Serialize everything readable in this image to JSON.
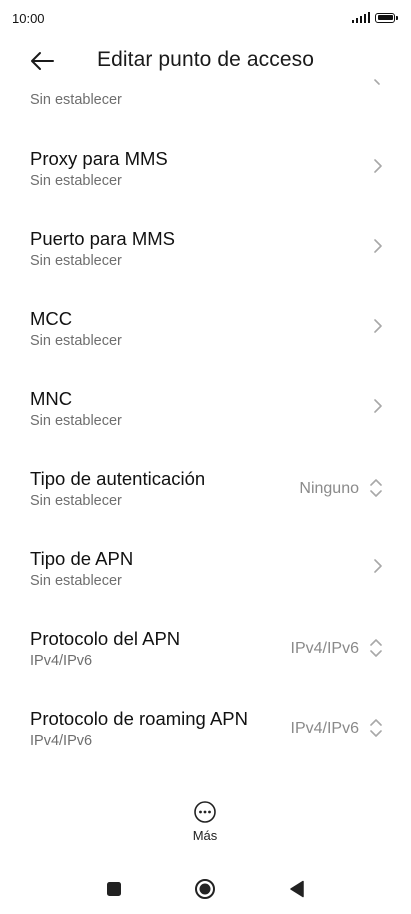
{
  "status_bar": {
    "time": "10:00"
  },
  "header": {
    "title": "Editar punto de acceso"
  },
  "partial_row": {
    "subtitle": "Sin establecer"
  },
  "rows": [
    {
      "title": "Proxy para MMS",
      "subtitle": "Sin establecer",
      "control": "chevron"
    },
    {
      "title": "Puerto para MMS",
      "subtitle": "Sin establecer",
      "control": "chevron"
    },
    {
      "title": "MCC",
      "subtitle": "Sin establecer",
      "control": "chevron"
    },
    {
      "title": "MNC",
      "subtitle": "Sin establecer",
      "control": "chevron"
    },
    {
      "title": "Tipo de autenticación",
      "subtitle": "Sin establecer",
      "control": "select",
      "value": "Ninguno"
    },
    {
      "title": "Tipo de APN",
      "subtitle": "Sin establecer",
      "control": "chevron"
    },
    {
      "title": "Protocolo del APN",
      "subtitle": "IPv4/IPv6",
      "control": "select",
      "value": "IPv4/IPv6"
    },
    {
      "title": "Protocolo de roaming APN",
      "subtitle": "IPv4/IPv6",
      "control": "select",
      "value": "IPv4/IPv6"
    }
  ],
  "footer": {
    "more_label": "Más"
  },
  "icons": {
    "back": "arrow-left-icon",
    "chevron": "chevron-right-icon",
    "select": "up-down-chevron-icon",
    "more": "more-dots-icon",
    "nav_recents": "square-icon",
    "nav_home": "circle-icon",
    "nav_back": "triangle-back-icon"
  },
  "colors": {
    "text": "#111111",
    "secondary": "#6e6e6e",
    "value": "#8a8a8a",
    "chevron": "#a8a8a8",
    "background": "#ffffff"
  }
}
